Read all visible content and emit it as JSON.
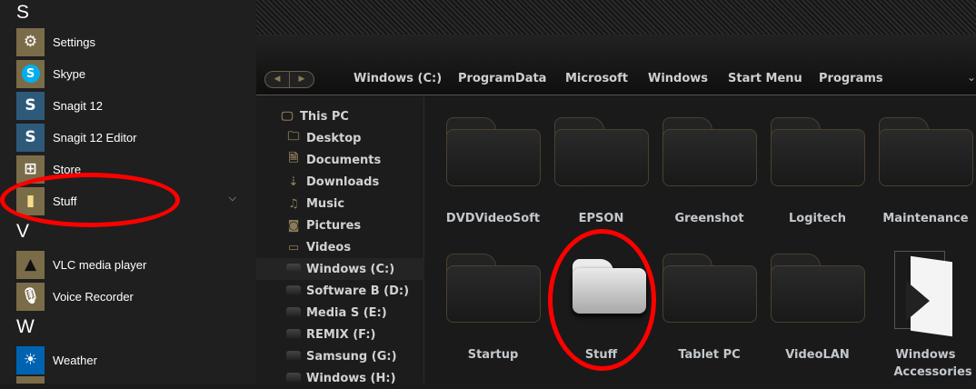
{
  "start_menu": {
    "groups": [
      {
        "letter": "S",
        "apps": [
          {
            "label": "Settings",
            "icon": "gear-icon"
          },
          {
            "label": "Skype",
            "icon": "skype-icon"
          },
          {
            "label": "Snagit 12",
            "icon": "snagit-icon"
          },
          {
            "label": "Snagit 12 Editor",
            "icon": "snagit-icon"
          },
          {
            "label": "Store",
            "icon": "store-icon"
          },
          {
            "label": "Stuff",
            "icon": "folder-icon",
            "expandable": true
          }
        ]
      },
      {
        "letter": "V",
        "apps": [
          {
            "label": "VLC media player",
            "icon": "vlc-icon"
          },
          {
            "label": "Voice Recorder",
            "icon": "microphone-icon"
          }
        ]
      },
      {
        "letter": "W",
        "apps": [
          {
            "label": "Weather",
            "icon": "sun-icon"
          }
        ]
      }
    ]
  },
  "explorer": {
    "breadcrumbs": [
      "Windows (C:)",
      "ProgramData",
      "Microsoft",
      "Windows",
      "Start Menu",
      "Programs"
    ],
    "tree": [
      {
        "label": "This PC",
        "icon": "monitor-icon"
      },
      {
        "label": "Desktop",
        "icon": "folder-icon"
      },
      {
        "label": "Documents",
        "icon": "document-icon"
      },
      {
        "label": "Downloads",
        "icon": "download-icon"
      },
      {
        "label": "Music",
        "icon": "music-icon"
      },
      {
        "label": "Pictures",
        "icon": "camera-icon"
      },
      {
        "label": "Videos",
        "icon": "video-icon"
      },
      {
        "label": "Windows (C:)",
        "icon": "drive-icon",
        "selected": true
      },
      {
        "label": "Software B (D:)",
        "icon": "drive-icon"
      },
      {
        "label": "Media S (E:)",
        "icon": "drive-icon"
      },
      {
        "label": "REMIX (F:)",
        "icon": "drive-icon"
      },
      {
        "label": "Samsung (G:)",
        "icon": "drive-icon"
      },
      {
        "label": "Windows (H:)",
        "icon": "drive-icon"
      }
    ],
    "folders": [
      {
        "label": "DVDVideoSoft"
      },
      {
        "label": "EPSON"
      },
      {
        "label": "Greenshot"
      },
      {
        "label": "Logitech"
      },
      {
        "label": "Maintenance"
      },
      {
        "label": "Startup"
      },
      {
        "label": "Stuff",
        "highlighted": true
      },
      {
        "label": "Tablet PC"
      },
      {
        "label": "VideoLAN"
      },
      {
        "label": "Windows Accessories"
      }
    ]
  },
  "colors": {
    "tile": "#7a6c48",
    "annotation": "#ff0000",
    "accent": "#8a7b58"
  }
}
